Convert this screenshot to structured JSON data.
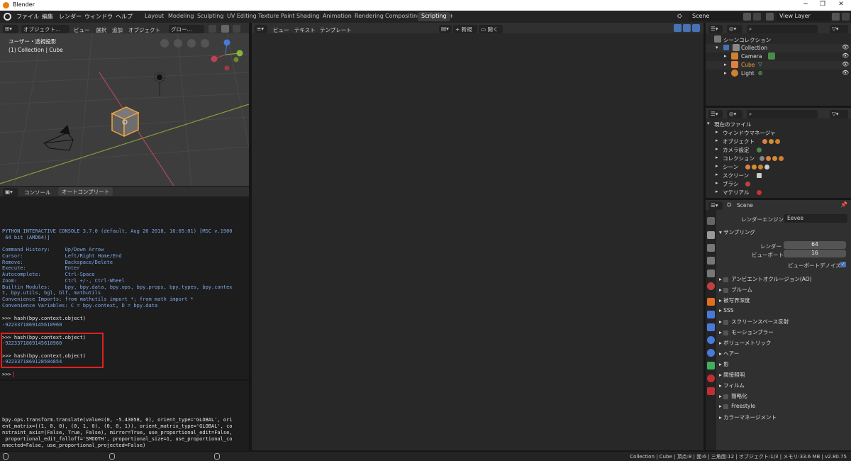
{
  "titlebar": {
    "title": "Blender"
  },
  "menubar": {
    "menus": [
      "ファイル",
      "編集",
      "レンダー",
      "ウィンドウ",
      "ヘルプ"
    ],
    "workspaces": [
      "Layout",
      "Modeling",
      "Sculpting",
      "UV Editing",
      "Texture Paint",
      "Shading",
      "Animation",
      "Rendering",
      "Compositing",
      "Scripting"
    ],
    "active_workspace": "Scripting",
    "add_tab": "+",
    "scene": "Scene",
    "view_layer": "View Layer"
  },
  "viewport": {
    "header": {
      "mode": "オブジェクト...",
      "view": "ビュー",
      "select": "選択",
      "add": "追加",
      "object": "オブジェクト",
      "orientation": "グロー..."
    },
    "overlay_title": "ユーザー・透視投影",
    "overlay_sub": "(1) Collection | Cube"
  },
  "console": {
    "tabs": [
      "コンソール",
      "オートコンプリート"
    ],
    "banner": "PYTHON INTERACTIVE CONSOLE 3.7.0 (default, Aug 26 2018, 16:05:01) [MSC v.1900",
    "banner2": " 64 bit (AMD64)]",
    "help": [
      "Command History:     Up/Down Arrow",
      "Cursor:              Left/Right Home/End",
      "Remove:              Backspace/Delete",
      "Execute:             Enter",
      "Autocomplete:        Ctrl-Space",
      "Zoom:                Ctrl +/-, Ctrl-Wheel",
      "Builtin Modules:     bpy, bpy.data, bpy.ops, bpy.props, bpy.types, bpy.contex",
      "t, bpy.utils, bgl, blf, mathutils",
      "Convenience Imports: from mathutils import *; from math import *",
      "Convenience Variables: C = bpy.context, D = bpy.data"
    ],
    "cmd1": ">>> hash(bpy.context.object)",
    "out1": "-9223371869145610960",
    "cmd2": ">>> hash(bpy.context.object)",
    "out2": "-9223371869145610960",
    "cmd3": ">>> hash(bpy.context.object)",
    "out3": "-9223371869128584854",
    "prompt": ">>> "
  },
  "info": {
    "lines": [
      "bpy.ops.transform.translate(value=(0, -5.43058, 0), orient_type='GLOBAL', ori",
      "ent_matrix=((1, 0, 0), (0, 1, 0), (0, 0, 1)), orient_matrix_type='GLOBAL', co",
      "nstraint_axis=(False, True, False), mirror=True, use_proportional_edit=False,",
      " proportional_edit_falloff='SMOOTH', proportional_size=1, use_proportional_co",
      "nnected=False, use_proportional_projected=False)"
    ]
  },
  "texteditor": {
    "view": "ビュー",
    "text": "テキスト",
    "template": "テンプレート",
    "new": "新規",
    "open": "開く"
  },
  "outliner": {
    "root": "シーンコレクション",
    "collection": "Collection",
    "items": [
      "Camera",
      "Cube",
      "Light"
    ]
  },
  "files": {
    "root": "現在のファイル",
    "items": [
      "ウィンドウマネージャ",
      "オブジェクト",
      "カメラ設定",
      "コレクション",
      "シーン",
      "スクリーン",
      "ブラシ",
      "マテリアル"
    ]
  },
  "properties": {
    "scene": "Scene",
    "render_engine_label": "レンダーエンジン",
    "render_engine": "Eevee",
    "sampling": "サンプリング",
    "render_label": "レンダー",
    "render_value": "64",
    "viewport_label": "ビューポート",
    "viewport_value": "16",
    "denoise": "ビューポートデノイズ",
    "sections": [
      "アンビエントオクルージョン(AO)",
      "ブルーム",
      "被写界深度",
      "SSS",
      "スクリーンスペース反射",
      "モーションブラー",
      "ボリューメトリック",
      "ヘアー",
      "影",
      "間接照明",
      "フィルム",
      "簡略化",
      "Freestyle",
      "カラーマネージメント"
    ]
  },
  "statusbar": {
    "text": "Collection | Cube | 頂点:8 | 面:6 | 三角面:12 | オブジェクト:1/3 | メモリ:33.6 MB | v2.80.75"
  },
  "colors": {
    "accent": "#4772b3",
    "orange_selection": "#f0a040",
    "highlight_box": "#e02020",
    "console_blue": "#7fa8e8"
  }
}
